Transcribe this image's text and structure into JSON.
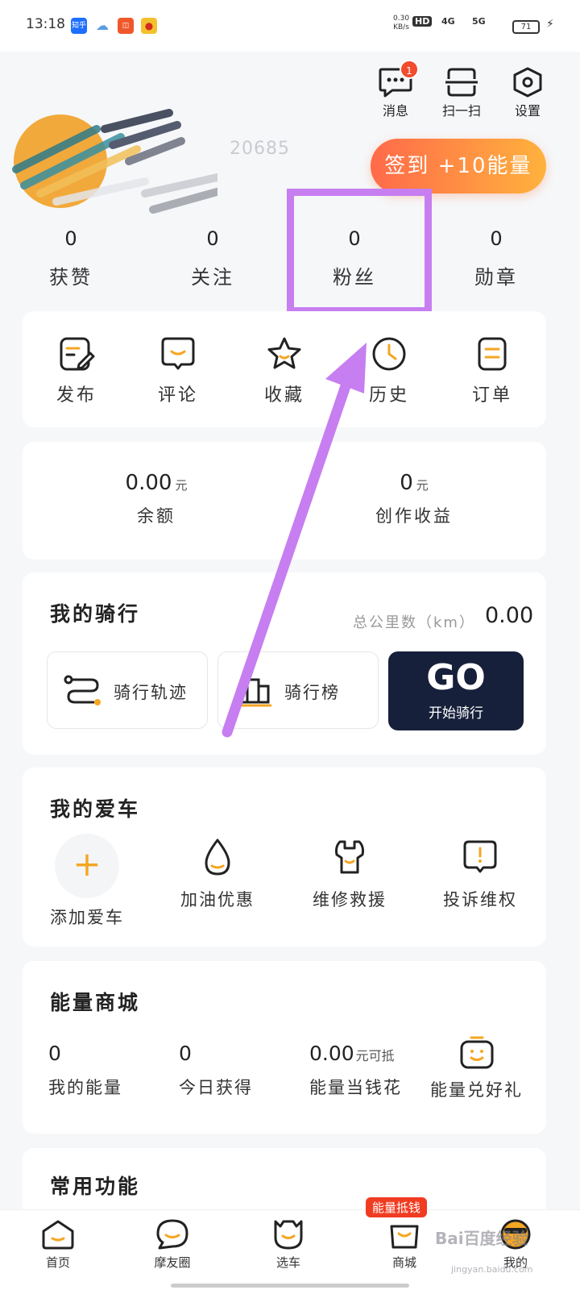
{
  "status_bar": {
    "time": "13:18",
    "apps": [
      "知乎",
      "",
      "",
      ""
    ],
    "net_speed": "0.30",
    "net_unit": "KB/s",
    "hd": "HD",
    "signal_1": "4G",
    "signal_2": "5G",
    "battery": "71"
  },
  "header": {
    "messages_label": "消息",
    "messages_badge": "1",
    "scan_label": "扫一扫",
    "settings_label": "设置"
  },
  "profile": {
    "user_id": "20685",
    "checkin_label": "签到 +10能量"
  },
  "stats": [
    {
      "value": "0",
      "label": "获赞"
    },
    {
      "value": "0",
      "label": "关注"
    },
    {
      "value": "0",
      "label": "粉丝"
    },
    {
      "value": "0",
      "label": "勋章"
    }
  ],
  "shortcuts": [
    {
      "label": "发布",
      "icon": "edit-icon"
    },
    {
      "label": "评论",
      "icon": "comment-icon"
    },
    {
      "label": "收藏",
      "icon": "star-icon"
    },
    {
      "label": "历史",
      "icon": "clock-icon"
    },
    {
      "label": "订单",
      "icon": "order-icon"
    }
  ],
  "wallet": {
    "balance_value": "0.00",
    "balance_unit": "元",
    "balance_label": "余额",
    "income_value": "0",
    "income_unit": "元",
    "income_label": "创作收益"
  },
  "riding": {
    "title": "我的骑行",
    "km_label": "总公里数（km）",
    "km_value": "0.00",
    "track_label": "骑行轨迹",
    "rank_label": "骑行榜",
    "go_label": "GO",
    "go_sub": "开始骑行"
  },
  "my_car": {
    "title": "我的爱车",
    "items": [
      {
        "label": "添加爱车",
        "icon": "plus-icon"
      },
      {
        "label": "加油优惠",
        "icon": "fuel-drop-icon"
      },
      {
        "label": "维修救援",
        "icon": "wrench-icon"
      },
      {
        "label": "投诉维权",
        "icon": "complaint-icon"
      }
    ]
  },
  "energy_mall": {
    "title": "能量商城",
    "my_energy_value": "0",
    "my_energy_label": "我的能量",
    "today_value": "0",
    "today_label": "今日获得",
    "cash_value": "0.00",
    "cash_unit": "元可抵",
    "cash_label": "能量当钱花",
    "gift_label": "能量兑好礼"
  },
  "common": {
    "title": "常用功能"
  },
  "bottom_nav": {
    "promo": "能量抵钱",
    "items": [
      {
        "label": "首页"
      },
      {
        "label": "摩友圈"
      },
      {
        "label": "选车"
      },
      {
        "label": "商城"
      },
      {
        "label": "我的"
      }
    ]
  },
  "watermark": {
    "text": "Bai百度经验",
    "sub": "jingyan.baidu.com"
  },
  "colors": {
    "accent": "#f5a623",
    "highlight": "#c77ef0",
    "go_bg": "#17203a"
  }
}
